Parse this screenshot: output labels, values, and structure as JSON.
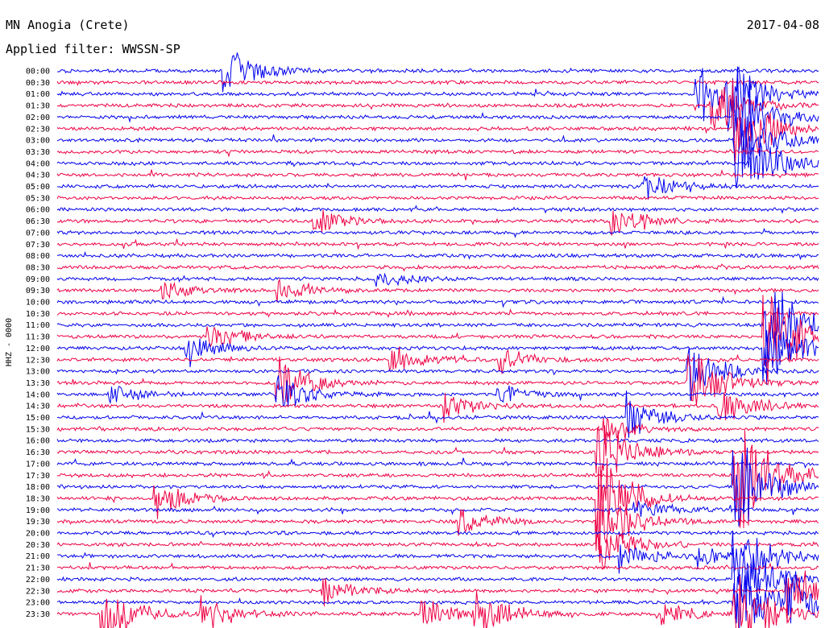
{
  "chart_data": {
    "type": "line",
    "title": "MN Anogia (Crete)",
    "subtitle": "Applied filter: WWSSN-SP",
    "date": "2017-04-08",
    "channel_label": "HHZ - 0000",
    "row_labels": [
      "00:00",
      "00:30",
      "01:00",
      "01:30",
      "02:00",
      "02:30",
      "03:00",
      "03:30",
      "04:00",
      "04:30",
      "05:00",
      "05:30",
      "06:00",
      "06:30",
      "07:00",
      "07:30",
      "08:00",
      "08:30",
      "09:00",
      "09:30",
      "10:00",
      "10:30",
      "11:00",
      "11:30",
      "12:00",
      "12:30",
      "13:00",
      "13:30",
      "14:00",
      "14:30",
      "15:00",
      "15:30",
      "16:00",
      "16:30",
      "17:00",
      "17:30",
      "18:00",
      "18:30",
      "19:00",
      "19:30",
      "20:00",
      "20:30",
      "21:00",
      "21:30",
      "22:00",
      "22:30",
      "23:00",
      "23:30"
    ],
    "colors": [
      "#0000ee",
      "#ee0044"
    ],
    "x_range_minutes": [
      0,
      30
    ],
    "grid": false,
    "events": [
      {
        "row": 0,
        "t": 0.22,
        "amp": 2.5
      },
      {
        "row": 2,
        "t": 0.84,
        "amp": 3.2
      },
      {
        "row": 2,
        "t": 0.88,
        "amp": 3.5
      },
      {
        "row": 3,
        "t": 0.86,
        "amp": 3.0
      },
      {
        "row": 4,
        "t": 0.89,
        "amp": 6.0
      },
      {
        "row": 5,
        "t": 0.89,
        "amp": 5.5
      },
      {
        "row": 6,
        "t": 0.89,
        "amp": 5.0
      },
      {
        "row": 8,
        "t": 0.91,
        "amp": 3.5
      },
      {
        "row": 10,
        "t": 0.77,
        "amp": 1.5
      },
      {
        "row": 13,
        "t": 0.34,
        "amp": 1.5
      },
      {
        "row": 13,
        "t": 0.73,
        "amp": 1.8
      },
      {
        "row": 18,
        "t": 0.42,
        "amp": 1.2
      },
      {
        "row": 19,
        "t": 0.14,
        "amp": 1.0
      },
      {
        "row": 19,
        "t": 0.29,
        "amp": 1.2
      },
      {
        "row": 22,
        "t": 0.93,
        "amp": 6.0
      },
      {
        "row": 23,
        "t": 0.2,
        "amp": 1.6
      },
      {
        "row": 23,
        "t": 0.93,
        "amp": 6.0
      },
      {
        "row": 24,
        "t": 0.17,
        "amp": 1.5
      },
      {
        "row": 24,
        "t": 0.93,
        "amp": 5.0
      },
      {
        "row": 25,
        "t": 0.44,
        "amp": 1.6
      },
      {
        "row": 25,
        "t": 0.58,
        "amp": 1.3
      },
      {
        "row": 26,
        "t": 0.83,
        "amp": 3.0
      },
      {
        "row": 27,
        "t": 0.29,
        "amp": 3.0
      },
      {
        "row": 27,
        "t": 0.83,
        "amp": 4.0
      },
      {
        "row": 28,
        "t": 0.29,
        "amp": 2.0
      },
      {
        "row": 28,
        "t": 0.07,
        "amp": 1.0
      },
      {
        "row": 28,
        "t": 0.58,
        "amp": 1.0
      },
      {
        "row": 29,
        "t": 0.51,
        "amp": 1.6
      },
      {
        "row": 29,
        "t": 0.87,
        "amp": 2.5
      },
      {
        "row": 30,
        "t": 0.75,
        "amp": 2.2
      },
      {
        "row": 31,
        "t": 0.72,
        "amp": 1.5
      },
      {
        "row": 33,
        "t": 0.71,
        "amp": 4.0
      },
      {
        "row": 35,
        "t": 0.89,
        "amp": 8.0
      },
      {
        "row": 36,
        "t": 0.89,
        "amp": 6.0
      },
      {
        "row": 37,
        "t": 0.13,
        "amp": 2.0
      },
      {
        "row": 37,
        "t": 0.71,
        "amp": 6.0
      },
      {
        "row": 38,
        "t": 0.76,
        "amp": 1.2
      },
      {
        "row": 39,
        "t": 0.53,
        "amp": 1.6
      },
      {
        "row": 39,
        "t": 0.71,
        "amp": 4.0
      },
      {
        "row": 41,
        "t": 0.71,
        "amp": 3.0
      },
      {
        "row": 42,
        "t": 0.74,
        "amp": 1.6
      },
      {
        "row": 42,
        "t": 0.84,
        "amp": 1.0
      },
      {
        "row": 42,
        "t": 0.89,
        "amp": 5.0
      },
      {
        "row": 44,
        "t": 0.89,
        "amp": 5.0
      },
      {
        "row": 45,
        "t": 0.35,
        "amp": 1.5
      },
      {
        "row": 45,
        "t": 0.96,
        "amp": 3.0
      },
      {
        "row": 46,
        "t": 0.89,
        "amp": 5.0
      },
      {
        "row": 46,
        "t": 0.96,
        "amp": 3.0
      },
      {
        "row": 47,
        "t": 0.06,
        "amp": 3.5
      },
      {
        "row": 47,
        "t": 0.19,
        "amp": 2.0
      },
      {
        "row": 47,
        "t": 0.48,
        "amp": 2.0
      },
      {
        "row": 47,
        "t": 0.55,
        "amp": 2.5
      },
      {
        "row": 47,
        "t": 0.79,
        "amp": 1.5
      },
      {
        "row": 47,
        "t": 0.89,
        "amp": 5.0
      }
    ]
  }
}
